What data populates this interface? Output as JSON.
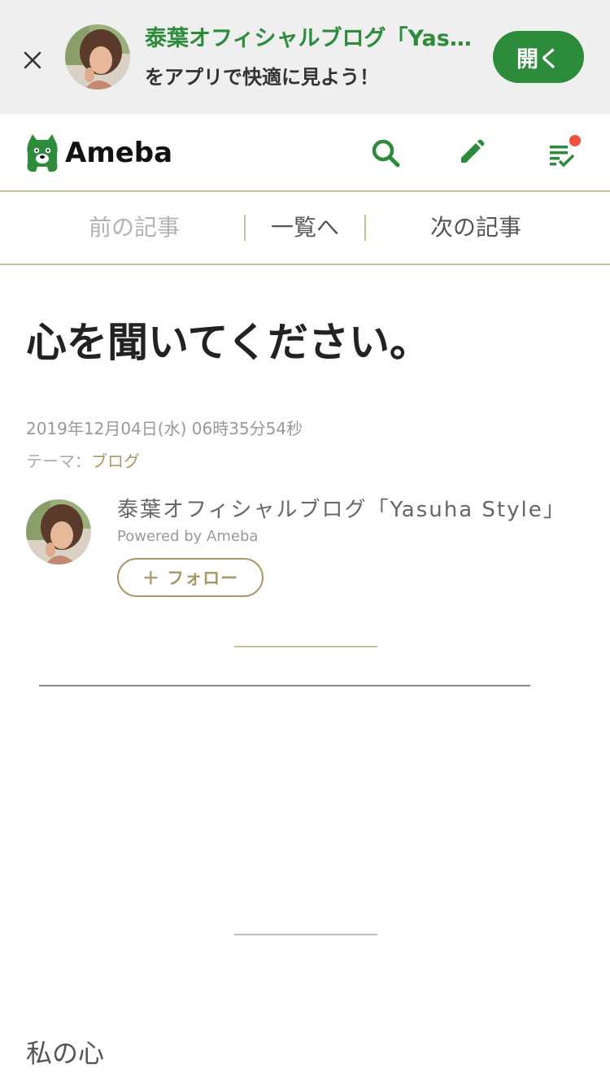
{
  "banner": {
    "title": "泰葉オフィシャルブログ「Yasuha Style」",
    "subtitle": "をアプリで快適に見よう！",
    "open_label": "開く"
  },
  "header": {
    "logo_text": "Ameba",
    "icons": [
      "search-icon",
      "pencil-icon",
      "checklist-icon"
    ],
    "accent_color": "#2d8c3c",
    "notification_color": "#f0503c"
  },
  "article_nav": {
    "prev": "前の記事",
    "list": "一覧へ",
    "next": "次の記事"
  },
  "entry": {
    "title": "心を聞いてください。",
    "date": "2019年12月04日(水) 06時35分54秒",
    "theme_label": "テーマ：",
    "theme_value": "ブログ",
    "body_first_line": "私の心"
  },
  "author": {
    "blog_name": "泰葉オフィシャルブログ「Yasuha Style」",
    "powered_by": "Powered by Ameba",
    "follow_label": "＋ フォロー"
  }
}
